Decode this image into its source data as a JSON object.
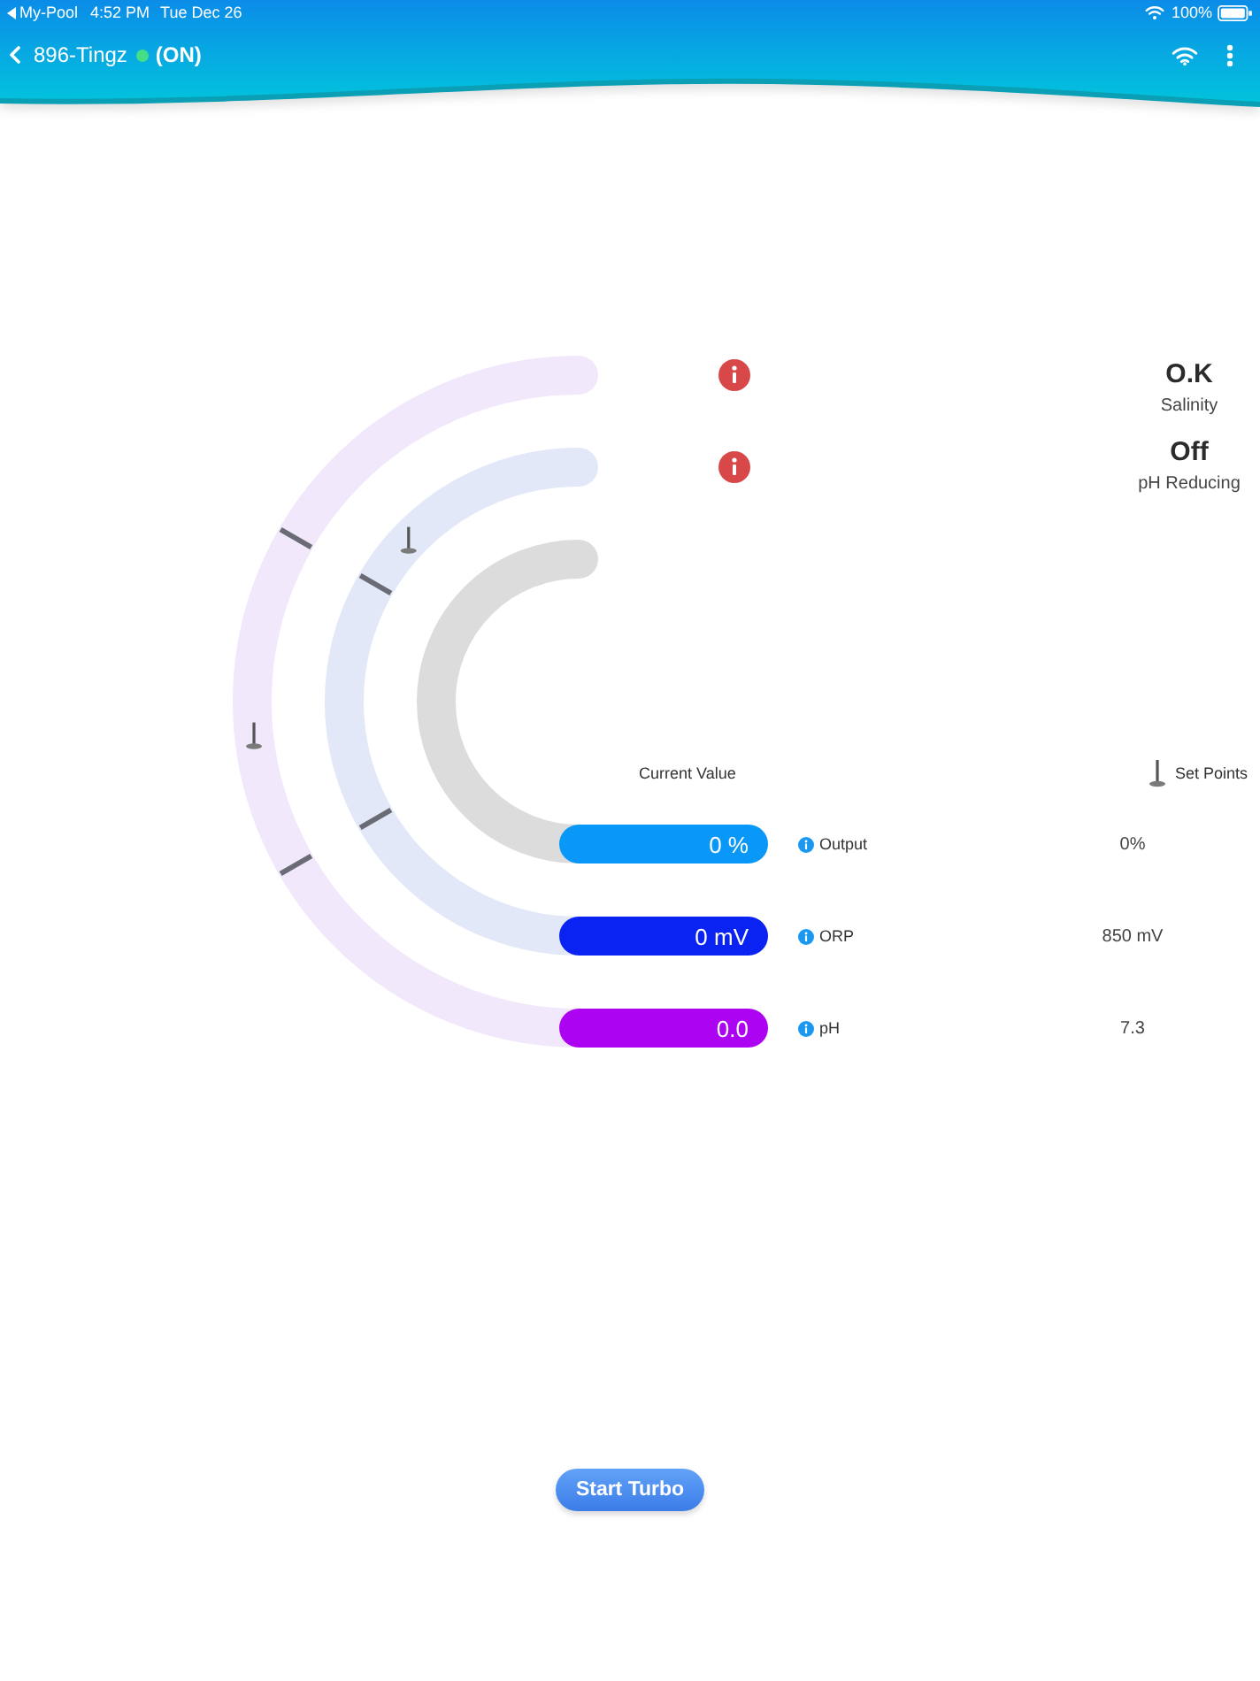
{
  "status_bar": {
    "app": "My-Pool",
    "time": "4:52 PM",
    "date": "Tue Dec 26",
    "battery": "100%"
  },
  "nav": {
    "title": "896-Tingz",
    "connected": true,
    "state": "(ON)"
  },
  "alerts": [
    {
      "status": "O.K",
      "label": "Salinity"
    },
    {
      "status": "Off",
      "label": "pH Reducing"
    }
  ],
  "gauges": {
    "current_heading": "Current Value",
    "setpoint_heading": "Set Points",
    "items": [
      {
        "label": "Output",
        "value": "0 %",
        "setpoint": "0%",
        "color": "#0a98f8"
      },
      {
        "label": "ORP",
        "value": "0 mV",
        "setpoint": "850 mV",
        "color": "#0a22f2"
      },
      {
        "label": "pH",
        "value": "0.0",
        "setpoint": "7.3",
        "color": "#ac04f2"
      }
    ]
  },
  "turbo_button": {
    "label": "Start Turbo"
  }
}
